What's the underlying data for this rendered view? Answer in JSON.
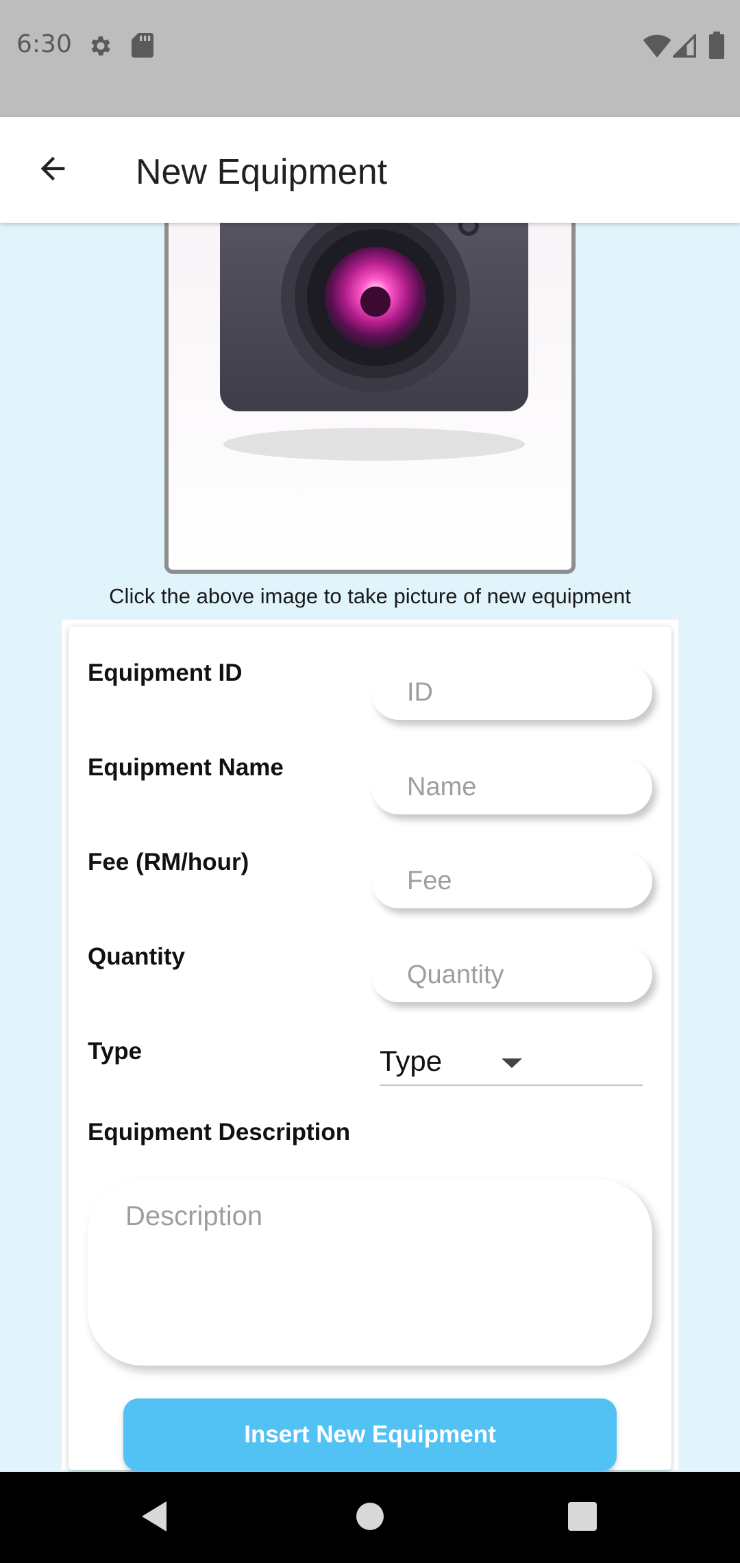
{
  "status_bar": {
    "time": "6:30",
    "icons": [
      "settings-icon",
      "sd-card-icon",
      "wifi-icon",
      "signal-icon",
      "battery-icon"
    ]
  },
  "app_bar": {
    "title": "New Equipment",
    "back_icon": "arrow-back-icon"
  },
  "image_picker": {
    "icon": "camera-icon",
    "caption": "Click the above image to take picture of new equipment"
  },
  "form": {
    "fields": [
      {
        "label": "Equipment ID",
        "placeholder": "ID",
        "value": ""
      },
      {
        "label": "Equipment Name",
        "placeholder": "Name",
        "value": ""
      },
      {
        "label": "Fee (RM/hour)",
        "placeholder": "Fee",
        "value": ""
      },
      {
        "label": "Quantity",
        "placeholder": "Quantity",
        "value": ""
      }
    ],
    "type": {
      "label": "Type",
      "selected": "Type"
    },
    "description": {
      "label": "Equipment Description",
      "placeholder": "Description",
      "value": ""
    },
    "submit_label": "Insert New Equipment"
  },
  "nav_bar": {
    "icons": [
      "back-triangle-icon",
      "home-circle-icon",
      "recents-square-icon"
    ]
  },
  "colors": {
    "background": "#e1f4fc",
    "accent_button": "#52c2f5",
    "status_bar": "#bdbdbd",
    "nav_bar": "#000000"
  }
}
